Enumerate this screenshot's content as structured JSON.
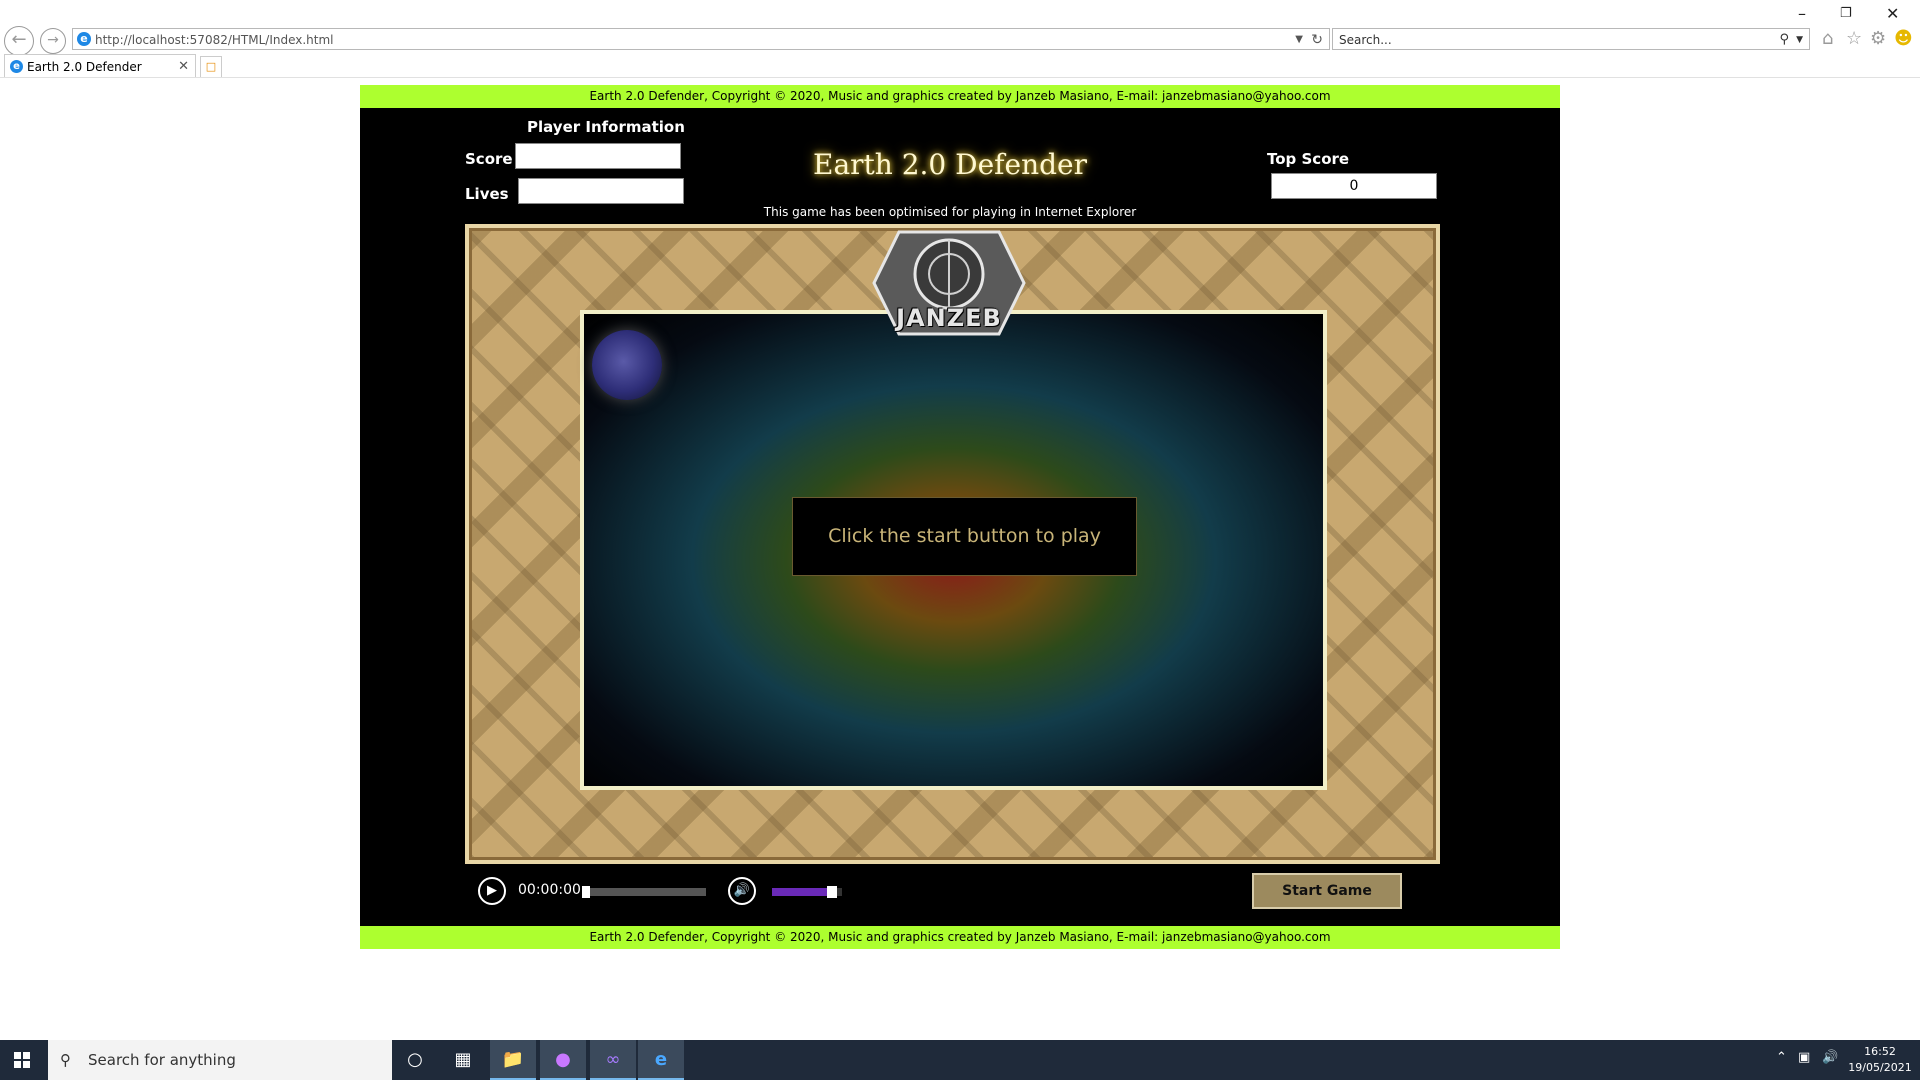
{
  "browser": {
    "url": "http://localhost:57082/HTML/Index.html",
    "search_placeholder": "Search...",
    "tab_title": "Earth 2.0 Defender"
  },
  "page": {
    "copyright": "Earth 2.0 Defender, Copyright © 2020, Music and graphics created by Janzeb Masiano, E-mail: janzebmasiano@yahoo.com",
    "player_info_title": "Player Information",
    "score_label": "Score",
    "score_value": "",
    "lives_label": "Lives",
    "lives_value": "",
    "game_title": "Earth 2.0 Defender",
    "optimised_note": "This game has been optimised for playing in Internet Explorer",
    "top_score_label": "Top Score",
    "top_score_value": "0",
    "logo_text": "JANZEB",
    "play_message": "Click the start button to play",
    "audio_time": "00:00:00",
    "audio_progress": 0,
    "audio_volume": 0.85,
    "start_button": "Start Game"
  },
  "taskbar": {
    "search_placeholder": "Search for anything",
    "time": "16:52",
    "date": "19/05/2021"
  },
  "colors": {
    "banner": "#adff2f",
    "title_glow": "#f2d64a",
    "volume": "#6a2ab8",
    "start_button": "#9c8a5e"
  }
}
